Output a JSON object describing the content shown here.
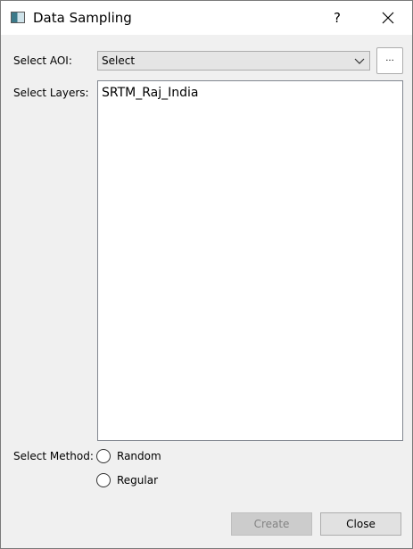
{
  "window": {
    "title": "Data Sampling",
    "help_label": "?"
  },
  "aoi": {
    "label": "Select AOI:",
    "selected": "Select",
    "browse_label": "..."
  },
  "layers": {
    "label": "Select Layers:",
    "items": [
      "SRTM_Raj_India"
    ]
  },
  "method": {
    "label": "Select Method:",
    "options": [
      {
        "label": "Random",
        "checked": false
      },
      {
        "label": "Regular",
        "checked": false
      }
    ]
  },
  "buttons": {
    "create": "Create",
    "close": "Close"
  },
  "icons": {
    "app": "app-window-icon",
    "close": "close-icon",
    "dropdown": "chevron-down-icon"
  }
}
